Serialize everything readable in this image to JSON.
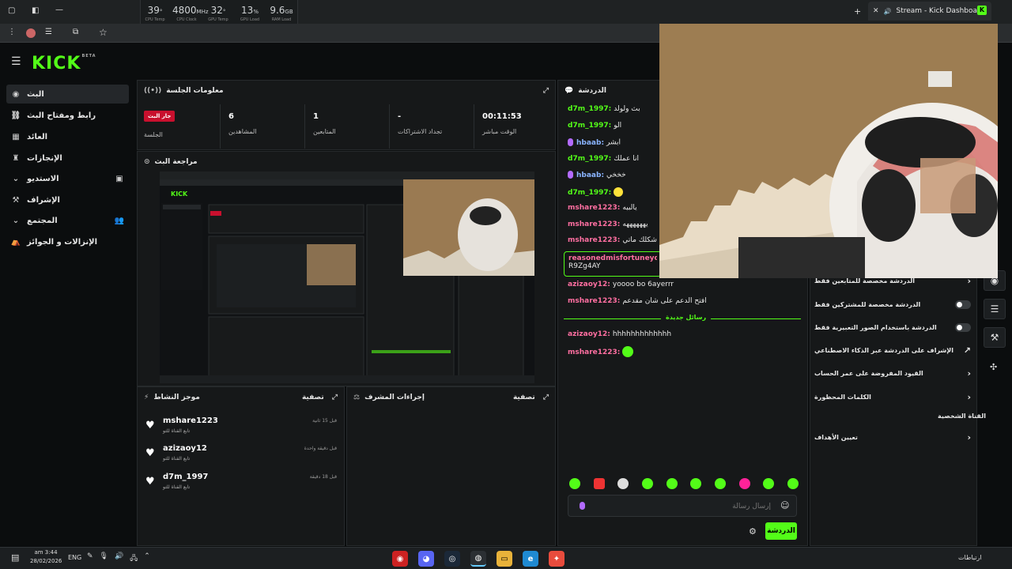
{
  "browser": {
    "tab_title": "Stream - Kick Dashboard",
    "hw": [
      {
        "value": "39",
        "unit": "°",
        "label": "CPU Temp"
      },
      {
        "value": "4800",
        "unit": "MHz",
        "label": "CPU Clock"
      },
      {
        "value": "32",
        "unit": "°",
        "label": "GPU Temp"
      },
      {
        "value": "13",
        "unit": "%",
        "label": "GPU Load"
      },
      {
        "value": "9.6",
        "unit": "GB",
        "label": "RAM Load"
      }
    ]
  },
  "logo": {
    "text": "KICK",
    "sup": "BETA"
  },
  "sidebar": {
    "items": [
      {
        "label": "البث",
        "icon": "live-icon"
      },
      {
        "label": "رابط ومفتاح البث",
        "icon": "link-icon"
      },
      {
        "label": "العائد",
        "icon": "revenue-icon"
      },
      {
        "label": "الإنجازات",
        "icon": "trophy-icon"
      },
      {
        "label": "الاستديو",
        "icon": "studio-icon"
      },
      {
        "label": "الإشراف",
        "icon": "moderation-icon"
      },
      {
        "label": "المجتمع",
        "icon": "community-icon"
      },
      {
        "label": "الإنزالات و الجوائز",
        "icon": "drops-icon"
      }
    ]
  },
  "session": {
    "title": "معلومات الجلسة",
    "badge": "جار البث",
    "badge_label": "الجلسة",
    "stats": [
      {
        "value": "6",
        "label": "المشاهدين"
      },
      {
        "value": "1",
        "label": "المتابعين"
      },
      {
        "value": "-",
        "label": "تجداد الاشتراكات"
      },
      {
        "value": "00:11:53",
        "label": "الوقت مباشر"
      }
    ]
  },
  "preview": {
    "title": "مراجعة البث"
  },
  "activity": {
    "title": "موجز النشاط",
    "filter": "تصفية",
    "items": [
      {
        "name": "mshare1223",
        "sub": "تابع القناة للتو",
        "time": "قبل 15 ثانية"
      },
      {
        "name": "azizaoy12",
        "sub": "تابع القناة للتو",
        "time": "قبل دقيقة واحدة"
      },
      {
        "name": "d7m_1997",
        "sub": "تابع القناة للتو",
        "time": "قبل 18 دقيقة"
      }
    ]
  },
  "mod_actions": {
    "title": "إجراءات المشرف",
    "filter": "تصفية"
  },
  "chat": {
    "title": "الدردشة",
    "messages": [
      {
        "user": "d7m_1997:",
        "text": "بث ولولد",
        "color": "green",
        "mic": false
      },
      {
        "user": "d7m_1997:",
        "text": "الو",
        "color": "green",
        "mic": false
      },
      {
        "user": "hbaab:",
        "text": "ابشر",
        "color": "blue",
        "mic": true
      },
      {
        "user": "d7m_1997:",
        "text": "انا عملك",
        "color": "green",
        "mic": false
      },
      {
        "user": "hbaab:",
        "text": "خخخي",
        "color": "blue",
        "mic": true
      },
      {
        "user": "d7m_1997:",
        "text": "",
        "color": "green",
        "mic": false
      },
      {
        "user": "mshare1223:",
        "text": "يالبيه",
        "color": "pink",
        "mic": false
      },
      {
        "user": "mshare1223:",
        "text": "يههههههه",
        "color": "pink",
        "mic": false
      },
      {
        "user": "mshare1223:",
        "text": "الدعم شكلك ماتي",
        "color": "pink",
        "mic": false
      }
    ],
    "pinned_user": "reasonedmisfortuneyqgb:",
    "pinned_text": "R9Zg4AY",
    "messages2": [
      {
        "user": "azizaoy12:",
        "text": "yoooo bo 6ayerrr",
        "color": "pink"
      },
      {
        "user": "mshare1223:",
        "text": "افتح الدعم على شان مقدعم",
        "color": "pink"
      }
    ],
    "new_messages": "رسائل جديدة",
    "messages3": [
      {
        "user": "azizaoy12:",
        "text": "hhhhhhhhhhhhh",
        "color": "pink"
      },
      {
        "user": "mshare1223:",
        "text": "",
        "color": "pink"
      }
    ],
    "input_placeholder": "إرسال رسالة",
    "send_label": "الدردشة"
  },
  "chat_settings": {
    "rows": [
      {
        "label": "الدردشة مخصصة للمتابعين فقط",
        "control": "chevron"
      },
      {
        "label": "الدردشة مخصصة للمشتركين فقط",
        "control": "toggle"
      },
      {
        "label": "الدردشة باستخدام الصور التعبيرية فقط",
        "control": "toggle"
      },
      {
        "label": "الإشراف على الدردشة عبر الذكاء الاصطناعي",
        "control": "external"
      },
      {
        "label": "القيود المفروضة على عمر الحساب",
        "control": "chevron"
      },
      {
        "label": "الكلمات المحظورة",
        "control": "chevron"
      }
    ],
    "section": "القناة الشخصية",
    "goals": "تعيين الأهداف"
  },
  "taskbar": {
    "time": "am 3:44",
    "date": "28/02/2026",
    "lang": "ENG",
    "right_label": "ارتباطات"
  }
}
